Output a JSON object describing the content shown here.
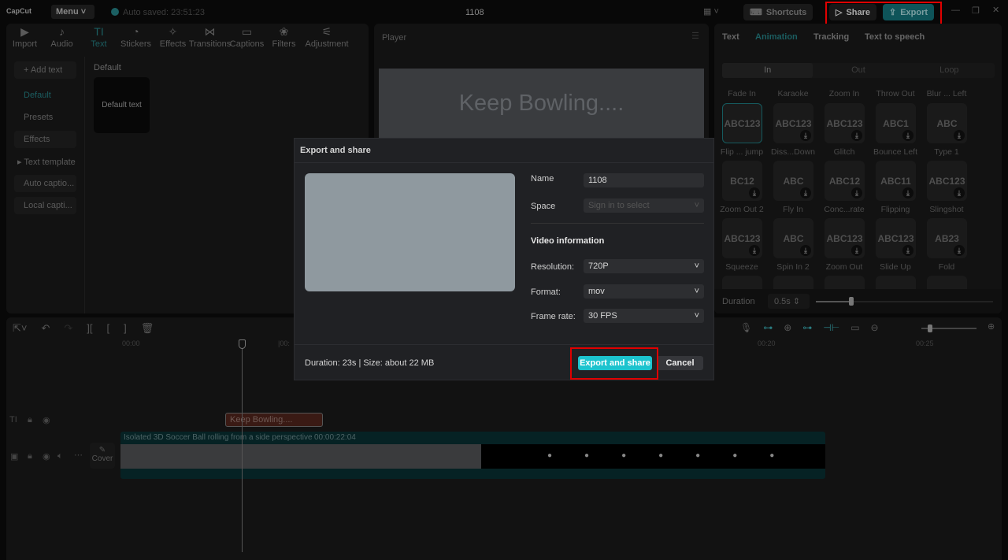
{
  "titlebar": {
    "logo": "CapCut",
    "menu": "Menu",
    "autosave": "Auto saved: 23:51:23",
    "project": "1108",
    "shortcuts": "Shortcuts",
    "share": "Share",
    "export": "Export"
  },
  "tools": [
    {
      "label": "Import",
      "icon": "▶"
    },
    {
      "label": "Audio",
      "icon": "♪"
    },
    {
      "label": "Text",
      "icon": "TI"
    },
    {
      "label": "Stickers",
      "icon": "◔"
    },
    {
      "label": "Effects",
      "icon": "✧"
    },
    {
      "label": "Transitions",
      "icon": "⋈"
    },
    {
      "label": "Captions",
      "icon": "▭"
    },
    {
      "label": "Filters",
      "icon": "❀"
    },
    {
      "label": "Adjustment",
      "icon": "⚟"
    }
  ],
  "sidebar": [
    "+ Add text",
    "Default",
    "Presets",
    "Effects",
    "▸ Text template",
    "Auto captio...",
    "Local capti..."
  ],
  "text_panel": {
    "section": "Default",
    "card": "Default text"
  },
  "player": {
    "title": "Player",
    "overlay_text": "Keep Bowling...."
  },
  "right": {
    "tabs": [
      "Text",
      "Animation",
      "Tracking",
      "Text to speech"
    ],
    "subtabs": [
      "In",
      "Out",
      "Loop"
    ],
    "labels_top": [
      "Fade In",
      "Karaoke",
      "Zoom In",
      "Throw Out",
      "Blur ... Left"
    ],
    "rows": [
      [
        "Flip ... jump",
        "Diss...Down",
        "Glitch",
        "Bounce Left",
        "Type 1"
      ],
      [
        "Zoom Out 2",
        "Fly In",
        "Conc...rate",
        "Flipping",
        "Slingshot"
      ],
      [
        "Squeeze",
        "Spin In 2",
        "Zoom Out",
        "Slide Up",
        "Fold"
      ]
    ],
    "thumbs": [
      [
        "ABC123",
        "ABC123",
        "ABC123",
        "ABC1",
        "ABC"
      ],
      [
        "BC12",
        "ABC",
        "ABC12",
        "ABC11",
        "ABC123"
      ],
      [
        "ABC123",
        "ABC",
        "ABC123",
        "ABC123",
        "AB23"
      ]
    ],
    "duration_label": "Duration",
    "duration_value": "0.5s",
    "duration_fraction": 0.2
  },
  "timeline": {
    "ticks": [
      "00:00",
      "|00:",
      "00:20",
      "00:25"
    ],
    "text_clip": "Keep Bowling....",
    "video_title": "Isolated 3D Soccer Ball rolling from a side perspective",
    "video_duration": "00:00:22:04",
    "cover": "Cover"
  },
  "modal": {
    "title": "Export and share",
    "name_label": "Name",
    "name_value": "1108",
    "space_label": "Space",
    "space_placeholder": "Sign in to select",
    "section": "Video information",
    "resolution_label": "Resolution:",
    "resolution": "720P",
    "format_label": "Format:",
    "format": "mov",
    "fps_label": "Frame rate:",
    "fps": "30 FPS",
    "summary": "Duration: 23s | Size: about 22 MB",
    "primary": "Export and share",
    "cancel": "Cancel"
  },
  "colors": {
    "accent": "#1cc3ce",
    "highlight": "#e00000"
  }
}
